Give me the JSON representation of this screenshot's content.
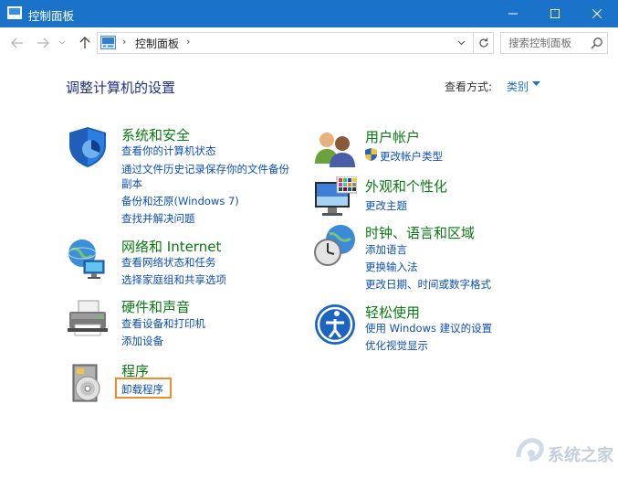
{
  "window": {
    "title": "控制面板",
    "buttons": [
      "minimize",
      "maximize",
      "close"
    ]
  },
  "address_bar": {
    "breadcrumb": "控制面板",
    "search_placeholder": "搜索控制面板"
  },
  "header": {
    "title": "调整计算机的设置",
    "view_by_label": "查看方式:",
    "view_by_value": "类别"
  },
  "categories": [
    {
      "title": "系统和安全",
      "icon": "shield-icon",
      "links": [
        "查看你的计算机状态",
        "通过文件历史记录保存你的文件备份",
        "副本",
        "备份和还原(Windows 7)",
        "查找并解决问题"
      ]
    },
    {
      "title": "网络和 Internet",
      "icon": "network-globe-icon",
      "links": [
        "查看网络状态和任务",
        "选择家庭组和共享选项"
      ]
    },
    {
      "title": "硬件和声音",
      "icon": "printer-icon",
      "links": [
        "查看设备和打印机",
        "添加设备"
      ]
    },
    {
      "title": "程序",
      "icon": "programs-disc-icon",
      "links": [
        "卸载程序"
      ]
    },
    {
      "title": "用户帐户",
      "icon": "users-icon",
      "links": [
        "更改帐户类型"
      ]
    },
    {
      "title": "外观和个性化",
      "icon": "monitor-palette-icon",
      "links": [
        "更改主题"
      ]
    },
    {
      "title": "时钟、语言和区域",
      "icon": "clock-globe-icon",
      "links": [
        "添加语言",
        "更换输入法",
        "更改日期、时间或数字格式"
      ]
    },
    {
      "title": "轻松使用",
      "icon": "ease-of-access-icon",
      "links": [
        "使用 Windows 建议的设置",
        "优化视觉显示"
      ]
    }
  ],
  "watermark": "系统之家",
  "colors": {
    "titlebar": "#1a73c9",
    "category_title": "#0a7a12",
    "link": "#0d4fb4",
    "heading": "#1e3287",
    "highlight_box": "#f08c2e"
  }
}
